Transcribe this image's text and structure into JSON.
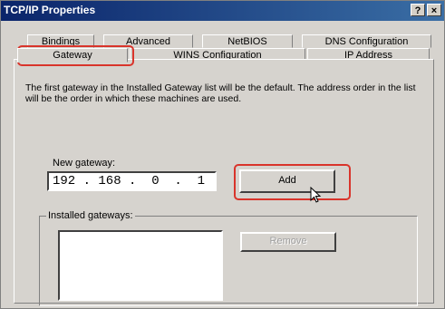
{
  "window": {
    "title": "TCP/IP Properties",
    "help_button": "?",
    "close_button": "×"
  },
  "tabs": {
    "row1": [
      {
        "label": "Bindings"
      },
      {
        "label": "Advanced"
      },
      {
        "label": "NetBIOS"
      },
      {
        "label": "DNS Configuration"
      }
    ],
    "row2": [
      {
        "label": "Gateway"
      },
      {
        "label": "WINS Configuration"
      },
      {
        "label": "IP Address"
      }
    ],
    "active_tab": "Gateway"
  },
  "gateway_panel": {
    "description": "The first gateway in the Installed Gateway list will be the default. The address order in the list will be the order in which these machines are used.",
    "new_gateway_label": "New gateway:",
    "new_gateway_value": "192 . 168 .  0  .  1",
    "add_button": "Add",
    "installed_gateways_label": "Installed gateways:",
    "installed_gateways": [],
    "remove_button": "Remove"
  },
  "colors": {
    "highlight": "#d9342b",
    "dialog_bg": "#d6d3ce",
    "titlebar_start": "#0a246a",
    "titlebar_end": "#3a6ea5"
  }
}
